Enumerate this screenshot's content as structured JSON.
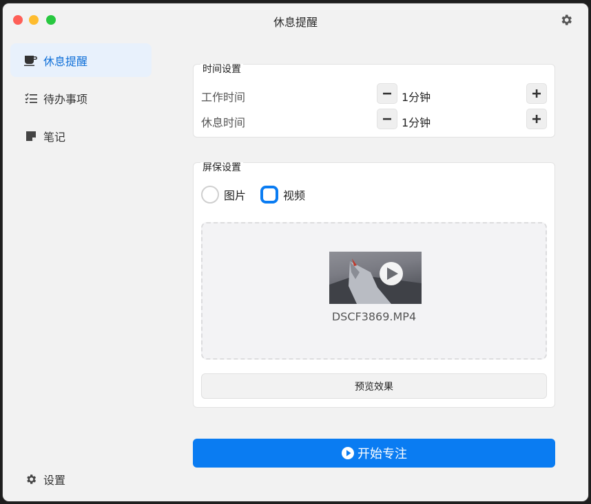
{
  "window": {
    "title": "休息提醒"
  },
  "sidebar": {
    "items": [
      {
        "label": "休息提醒",
        "icon": "coffee-icon",
        "active": true
      },
      {
        "label": "待办事项",
        "icon": "checklist-icon",
        "active": false
      },
      {
        "label": "笔记",
        "icon": "note-icon",
        "active": false
      }
    ],
    "settings_label": "设置"
  },
  "time_settings": {
    "legend": "时间设置",
    "work": {
      "label": "工作时间",
      "value": "1分钟"
    },
    "rest": {
      "label": "休息时间",
      "value": "1分钟"
    }
  },
  "screen_settings": {
    "legend": "屏保设置",
    "options": [
      {
        "label": "图片",
        "selected": false
      },
      {
        "label": "视频",
        "selected": true
      }
    ],
    "file_name": "DSCF3869.MP4",
    "preview_label": "预览效果"
  },
  "start_button": {
    "label": "开始专注"
  },
  "colors": {
    "accent": "#0a7cf2",
    "active_bg": "#e8f1fc"
  }
}
